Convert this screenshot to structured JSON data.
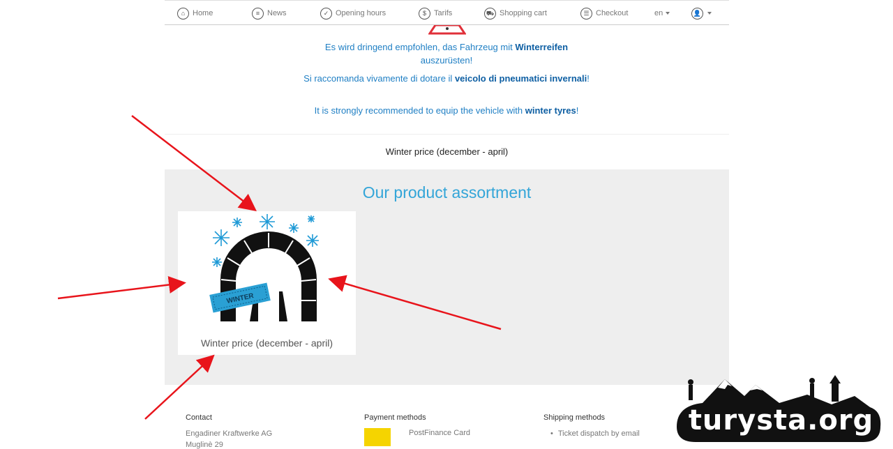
{
  "nav": {
    "items": [
      {
        "label": "Home",
        "icon": "home-icon"
      },
      {
        "label": "News",
        "icon": "news-icon"
      },
      {
        "label": "Opening hours",
        "icon": "clock-icon"
      },
      {
        "label": "Tarifs",
        "icon": "tariff-icon"
      },
      {
        "label": "Shopping cart",
        "icon": "cart-icon"
      },
      {
        "label": "Checkout",
        "icon": "checkout-icon"
      }
    ],
    "language": "en",
    "user_icon": "user-icon"
  },
  "notice": {
    "de_pre": "Es wird dringend empfohlen, das Fahrzeug mit ",
    "de_bold": "Winterreifen",
    "de_post": " auszurüsten!",
    "it_pre": "Si raccomanda vivamente di dotare il ",
    "it_bold": "veicolo di pneumatici invernali",
    "it_post": "!",
    "en_pre": "It is strongly recommended to equip the vehicle with ",
    "en_bold": "winter tyres",
    "en_post": "!"
  },
  "winter_heading": "Winter price (december - april)",
  "assortment": {
    "title": "Our product assortment",
    "products": [
      {
        "label": "Winter price (december - april)",
        "ticket_text": "WINTER"
      }
    ]
  },
  "footer": {
    "contact": {
      "title": "Contact",
      "lines": [
        "Engadiner Kraftwerke AG",
        "Muglinè 29"
      ]
    },
    "payment": {
      "title": "Payment methods",
      "methods": [
        "PostFinance Card"
      ]
    },
    "shipping": {
      "title": "Shipping methods",
      "methods": [
        "Ticket dispatch by email"
      ]
    }
  },
  "watermark": {
    "text": "turysta.org"
  },
  "colors": {
    "accent": "#33a5d8",
    "notice": "#1f7fc4",
    "arrow": "#e8141b",
    "ticket": "#2aa0d4"
  }
}
